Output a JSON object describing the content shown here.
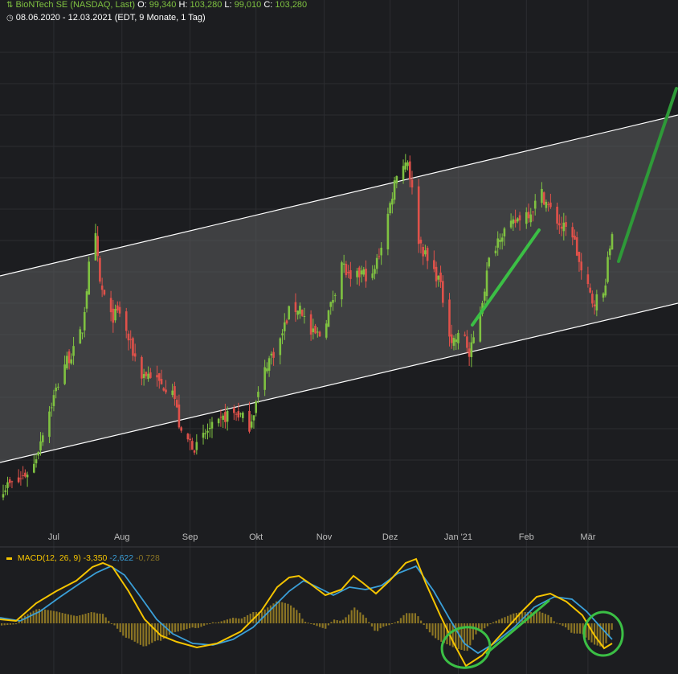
{
  "header": {
    "symbol_icon": "candlestick-icon",
    "title": "BioNTech SE (NASDAQ, Last)",
    "open_label": "O:",
    "open": "99,340",
    "high_label": "H:",
    "high": "103,280",
    "low_label": "L:",
    "low": "99,010",
    "close_label": "C:",
    "close": "103,280",
    "clock_icon": "clock-icon",
    "range": "08.06.2020 - 12.03.2021",
    "interval": "(EDT, 9 Monate, 1 Tag)"
  },
  "macd_legend": {
    "name": "MACD(12, 26, 9)",
    "macd": "-3,350",
    "signal": "-2,622",
    "histogram": "-0,728"
  },
  "colors": {
    "background": "#1c1d20",
    "grid": "#2c2d31",
    "channel_fill": "#5c5c5f",
    "up": "#7fc241",
    "down": "#e0514a",
    "annotation": "#3bbf45",
    "macd": "#f5c400",
    "signal": "#3a9fd8",
    "hist": "#8a7424"
  },
  "chart_data": [
    {
      "type": "candlestick",
      "x_ticks": [
        "Jul",
        "Aug",
        "Sep",
        "Okt",
        "Nov",
        "Dez",
        "Jan '21",
        "Feb",
        "Mär"
      ],
      "x_range": [
        "2020-06-08",
        "2021-03-12"
      ],
      "ylim": [
        52,
        140
      ],
      "grid": true,
      "close_series": [
        [
          "2020-06-08",
          58
        ],
        [
          "2020-06-15",
          59
        ],
        [
          "2020-06-22",
          62
        ],
        [
          "2020-06-26",
          68
        ],
        [
          "2020-07-01",
          74
        ],
        [
          "2020-07-06",
          80
        ],
        [
          "2020-07-10",
          82
        ],
        [
          "2020-07-14",
          86
        ],
        [
          "2020-07-17",
          97
        ],
        [
          "2020-07-20",
          102
        ],
        [
          "2020-07-22",
          94
        ],
        [
          "2020-07-27",
          88
        ],
        [
          "2020-07-31",
          89
        ],
        [
          "2020-08-05",
          83
        ],
        [
          "2020-08-10",
          78
        ],
        [
          "2020-08-14",
          78
        ],
        [
          "2020-08-19",
          76
        ],
        [
          "2020-08-24",
          76
        ],
        [
          "2020-08-28",
          67
        ],
        [
          "2020-09-01",
          66
        ],
        [
          "2020-09-04",
          65
        ],
        [
          "2020-09-09",
          68
        ],
        [
          "2020-09-14",
          69
        ],
        [
          "2020-09-18",
          71
        ],
        [
          "2020-09-23",
          71
        ],
        [
          "2020-09-28",
          69
        ],
        [
          "2020-10-01",
          73
        ],
        [
          "2020-10-06",
          80
        ],
        [
          "2020-10-12",
          84
        ],
        [
          "2020-10-16",
          89
        ],
        [
          "2020-10-21",
          90
        ],
        [
          "2020-10-26",
          85
        ],
        [
          "2020-10-30",
          85
        ],
        [
          "2020-11-04",
          90
        ],
        [
          "2020-11-09",
          98
        ],
        [
          "2020-11-13",
          94
        ],
        [
          "2020-11-18",
          96
        ],
        [
          "2020-11-23",
          95
        ],
        [
          "2020-11-27",
          101
        ],
        [
          "2020-12-01",
          108
        ],
        [
          "2020-12-04",
          114
        ],
        [
          "2020-12-09",
          116
        ],
        [
          "2020-12-14",
          102
        ],
        [
          "2020-12-18",
          98
        ],
        [
          "2020-12-23",
          95
        ],
        [
          "2020-12-29",
          84
        ],
        [
          "2021-01-04",
          85
        ],
        [
          "2021-01-06",
          81
        ],
        [
          "2021-01-11",
          89
        ],
        [
          "2021-01-15",
          98
        ],
        [
          "2021-01-20",
          103
        ],
        [
          "2021-01-25",
          104
        ],
        [
          "2021-01-29",
          106
        ],
        [
          "2021-02-03",
          107
        ],
        [
          "2021-02-08",
          110
        ],
        [
          "2021-02-12",
          107
        ],
        [
          "2021-02-17",
          104
        ],
        [
          "2021-02-22",
          103
        ],
        [
          "2021-02-26",
          96
        ],
        [
          "2021-03-03",
          91
        ],
        [
          "2021-03-08",
          92
        ],
        [
          "2021-03-12",
          103.28
        ]
      ]
    },
    {
      "type": "line",
      "series": [
        {
          "name": "MACD(12, 26, 9)"
        }
      ]
    }
  ]
}
